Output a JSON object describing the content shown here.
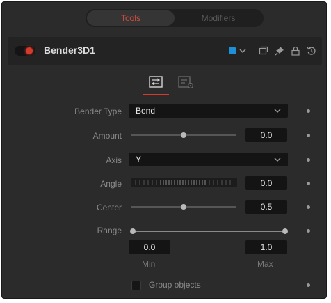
{
  "tabs": {
    "tools": "Tools",
    "modifiers": "Modifiers"
  },
  "node": {
    "name": "Bender3D1",
    "color_chip": "#1e90d8",
    "enabled_color": "#d53b2d"
  },
  "icons": {
    "header": [
      "color-dropdown-chevron-icon",
      "versions-icon",
      "pin-icon",
      "lock-icon",
      "reset-icon"
    ],
    "subtabs": [
      "controls-icon",
      "settings-icon"
    ]
  },
  "params": {
    "bender_type": {
      "label": "Bender Type",
      "value": "Bend"
    },
    "amount": {
      "label": "Amount",
      "value": "0.0",
      "slider": 0.5
    },
    "axis": {
      "label": "Axis",
      "value": "Y"
    },
    "angle": {
      "label": "Angle",
      "value": "0.0"
    },
    "center": {
      "label": "Center",
      "value": "0.5",
      "slider": 0.5
    },
    "range": {
      "label": "Range",
      "min_value": "0.0",
      "max_value": "1.0",
      "min_label": "Min",
      "max_label": "Max"
    },
    "group_objects": {
      "label": "Group objects",
      "checked": false
    }
  },
  "accent": "#d53b2d"
}
